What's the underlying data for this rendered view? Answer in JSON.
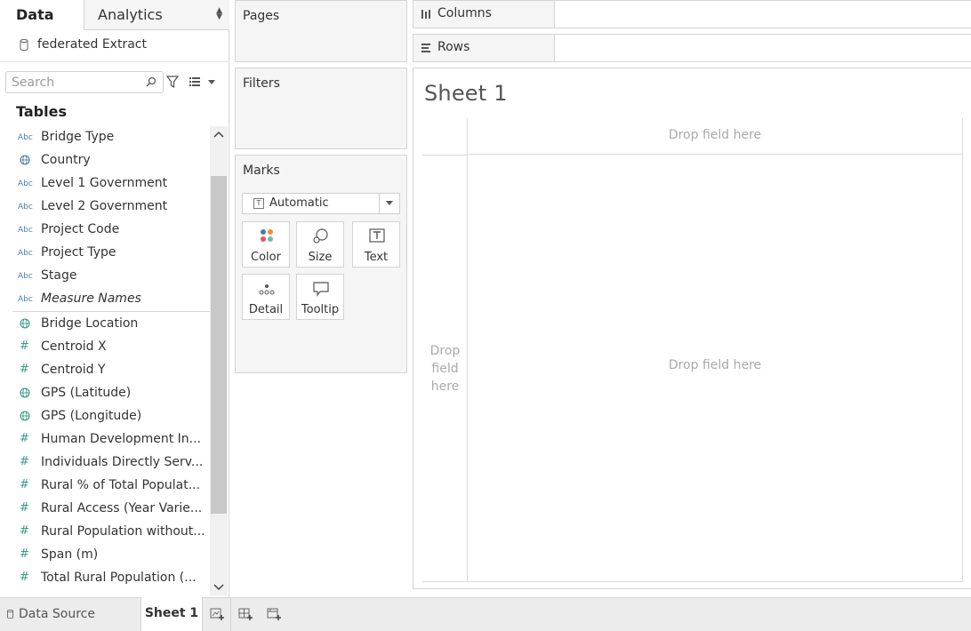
{
  "pane_tabs": {
    "data": "Data",
    "analytics": "Analytics"
  },
  "datasource": {
    "name": "federated Extract"
  },
  "search": {
    "placeholder": "Search"
  },
  "tables_heading": "Tables",
  "fields": [
    {
      "name": "Bridge Type",
      "type": "abc",
      "icon": "abc-icon"
    },
    {
      "name": "Country",
      "type": "globe",
      "icon": "globe-icon"
    },
    {
      "name": "Level 1 Government",
      "type": "abc",
      "icon": "abc-icon"
    },
    {
      "name": "Level 2 Government",
      "type": "abc",
      "icon": "abc-icon"
    },
    {
      "name": "Project Code",
      "type": "abc",
      "icon": "abc-icon"
    },
    {
      "name": "Project Type",
      "type": "abc",
      "icon": "abc-icon"
    },
    {
      "name": "Stage",
      "type": "abc",
      "icon": "abc-icon"
    },
    {
      "name": "Measure Names",
      "type": "abc",
      "icon": "abc-icon"
    },
    {
      "name": "Bridge Location",
      "type": "globe",
      "icon": "globe-icon"
    },
    {
      "name": "Centroid X",
      "type": "number",
      "icon": "hash-icon"
    },
    {
      "name": "Centroid Y",
      "type": "number",
      "icon": "hash-icon"
    },
    {
      "name": "GPS (Latitude)",
      "type": "globe",
      "icon": "globe-icon"
    },
    {
      "name": "GPS (Longitude)",
      "type": "globe",
      "icon": "globe-icon"
    },
    {
      "name": "Human Development In...",
      "type": "number",
      "icon": "hash-icon"
    },
    {
      "name": "Individuals Directly Serv...",
      "type": "number",
      "icon": "hash-icon"
    },
    {
      "name": "Rural % of Total Populat...",
      "type": "number",
      "icon": "hash-icon"
    },
    {
      "name": "Rural Access (Year Varie...",
      "type": "number",
      "icon": "hash-icon"
    },
    {
      "name": "Rural Population without...",
      "type": "number",
      "icon": "hash-icon"
    },
    {
      "name": "Span (m)",
      "type": "number",
      "icon": "hash-icon"
    },
    {
      "name": "Total Rural Population (...",
      "type": "number",
      "icon": "hash-icon"
    }
  ],
  "field_type_labels": {
    "abc": "Abc",
    "number": "#"
  },
  "cards": {
    "pages": "Pages",
    "filters": "Filters",
    "marks": "Marks"
  },
  "marks": {
    "type": "Automatic",
    "buttons": {
      "color": "Color",
      "size": "Size",
      "text": "Text",
      "detail": "Detail",
      "tooltip": "Tooltip"
    }
  },
  "shelves": {
    "columns": "Columns",
    "rows": "Rows"
  },
  "sheet": {
    "title": "Sheet 1",
    "drop_column": "Drop field here",
    "drop_row": "Drop\nfield\nhere",
    "drop_main": "Drop field here"
  },
  "bottom": {
    "data_source": "Data Source",
    "sheet_tab": "Sheet 1"
  },
  "colors": {
    "dimension_icon": "#4d7fa5",
    "measure_icon": "#3a9a86",
    "pane_bg": "#f5f5f5",
    "placeholder_text": "#aaaaaa"
  }
}
